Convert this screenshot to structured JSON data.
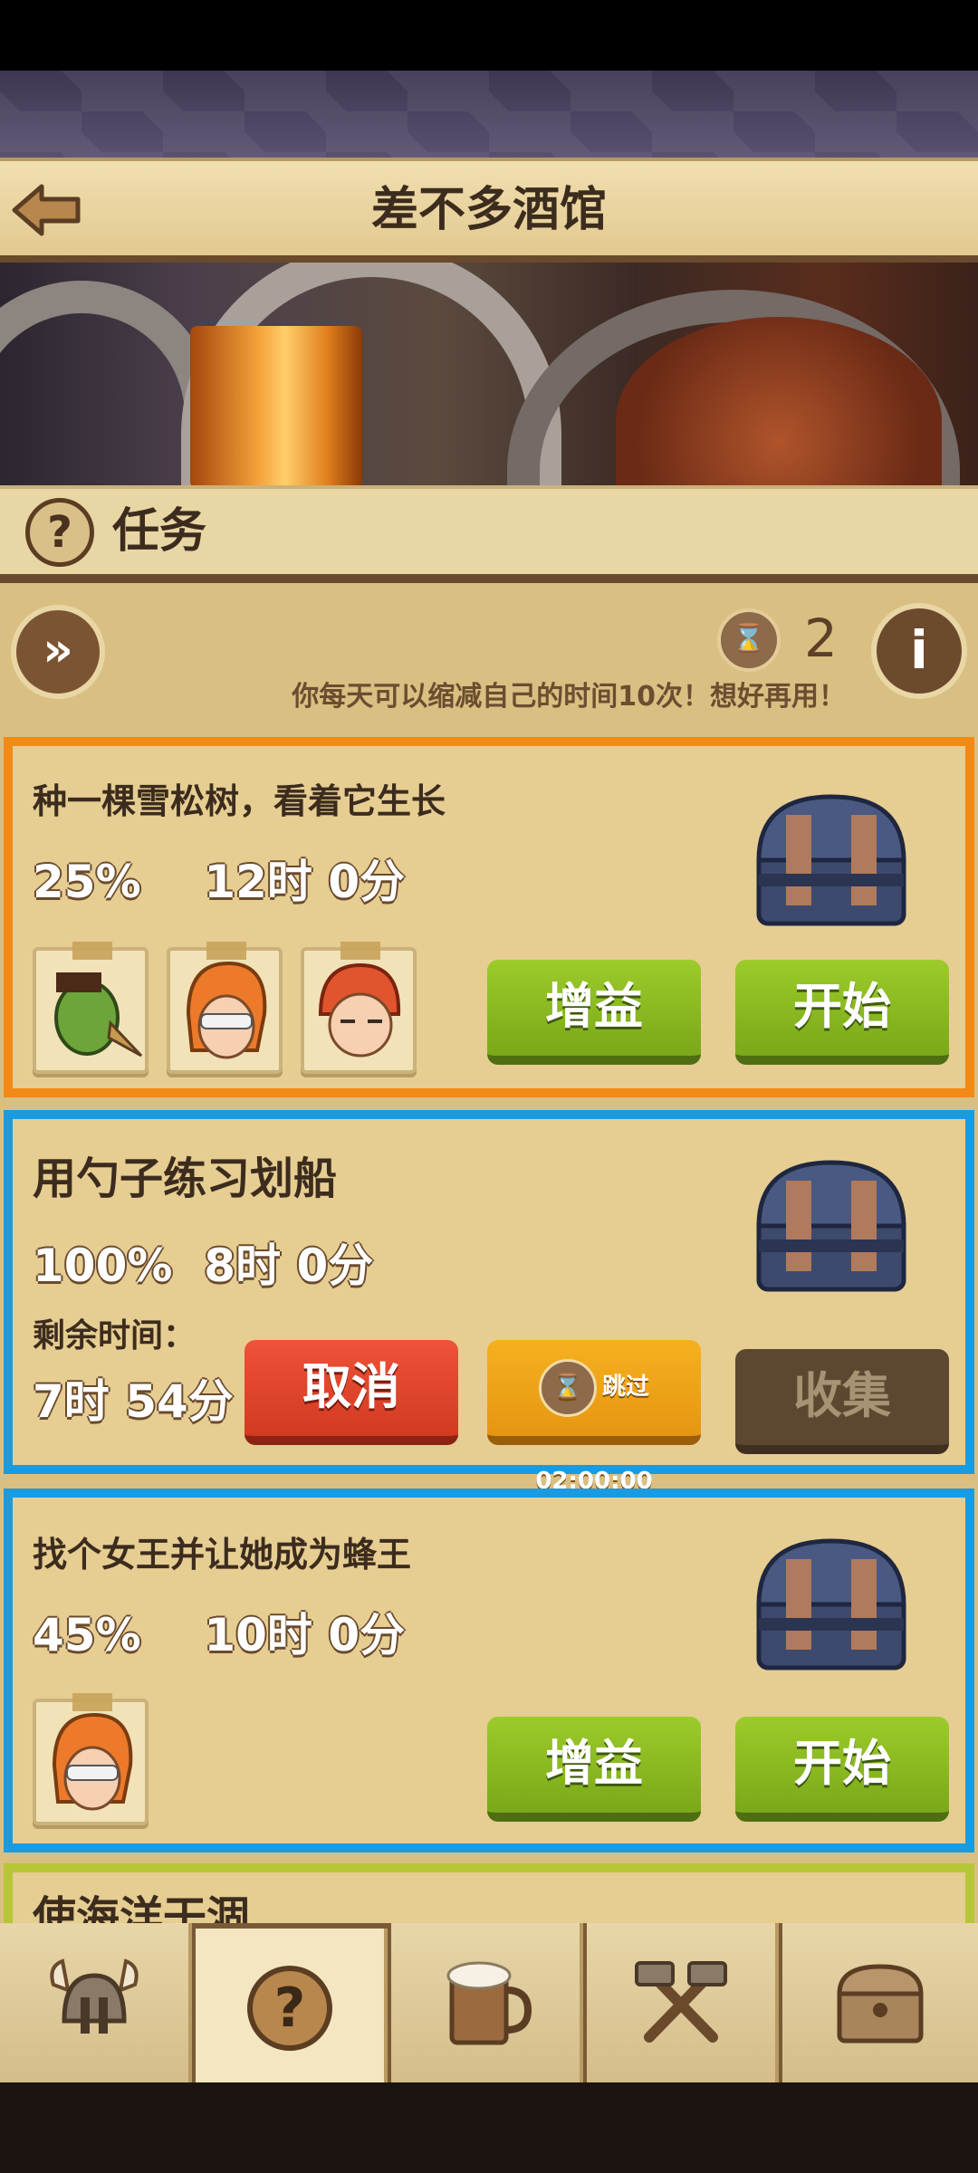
{
  "header": {
    "title": "差不多酒馆",
    "back_icon": "back-arrow-icon"
  },
  "section": {
    "title": "任务",
    "icon": "question-icon"
  },
  "toolbar": {
    "fast_forward_icon": "fast-forward-icon",
    "ticket_icon": "time-ticket-icon",
    "ticket_count": "2",
    "info_icon": "info-icon",
    "notice": "你每天可以缩减自己的时间10次！想好再用！"
  },
  "quests": [
    {
      "title": "种一棵雪松树，看着它生长",
      "percent": "25%",
      "duration": "12时 0分",
      "boost_label": "增益",
      "start_label": "开始",
      "border_color": "#f18a17"
    },
    {
      "title": "用勺子练习划船",
      "percent": "100%",
      "duration": "8时 0分",
      "remaining_label": "剩余时间：",
      "remaining_value": "7时 54分",
      "cancel_label": "取消",
      "skip_label": "跳过02:00:00",
      "collect_label": "收集",
      "border_color": "#1a9be0"
    },
    {
      "title": "找个女王并让她成为蜂王",
      "percent": "45%",
      "duration": "10时 0分",
      "boost_label": "增益",
      "start_label": "开始",
      "border_color": "#1a9be0"
    },
    {
      "title": "使海洋干涸"
    }
  ],
  "nav": [
    {
      "name": "heroes",
      "icon": "viking-helmet-icon"
    },
    {
      "name": "quests",
      "icon": "question-icon",
      "active": true
    },
    {
      "name": "tavern",
      "icon": "beer-mug-icon"
    },
    {
      "name": "forge",
      "icon": "crossed-hammers-icon"
    },
    {
      "name": "storage",
      "icon": "treasure-chest-icon"
    }
  ]
}
